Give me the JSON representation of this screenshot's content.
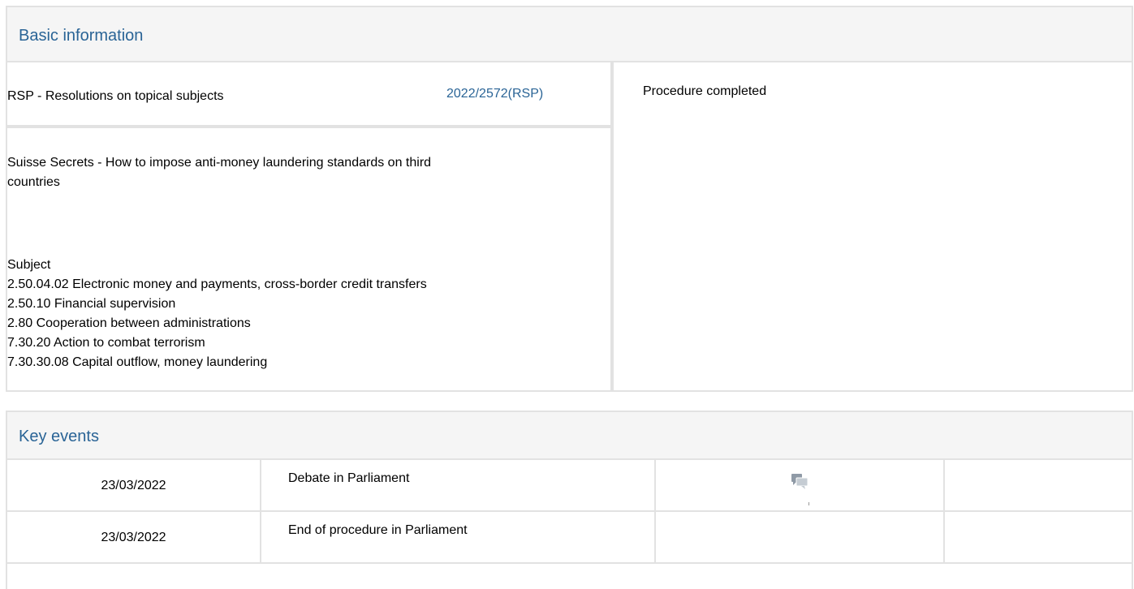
{
  "basic_info": {
    "title": "Basic information",
    "procedure_type": "RSP - Resolutions on topical subjects",
    "reference": "2022/2572(RSP)",
    "status": "Procedure completed",
    "description_line1": "Suisse Secrets - How to impose anti-money laundering standards on third",
    "description_line2": "countries",
    "subject_heading": "Subject",
    "subjects": [
      "2.50.04.02 Electronic money and payments, cross-border credit transfers",
      "2.50.10 Financial supervision",
      "2.80 Cooperation between administrations",
      "7.30.20 Action to combat terrorism",
      "7.30.30.08 Capital outflow, money laundering"
    ]
  },
  "key_events": {
    "title": "Key events",
    "rows": [
      {
        "date": "23/03/2022",
        "event": "Debate in Parliament",
        "icon": "chat-bubbles-icon"
      },
      {
        "date": "23/03/2022",
        "event": "End of procedure in Parliament",
        "icon": ""
      }
    ]
  }
}
